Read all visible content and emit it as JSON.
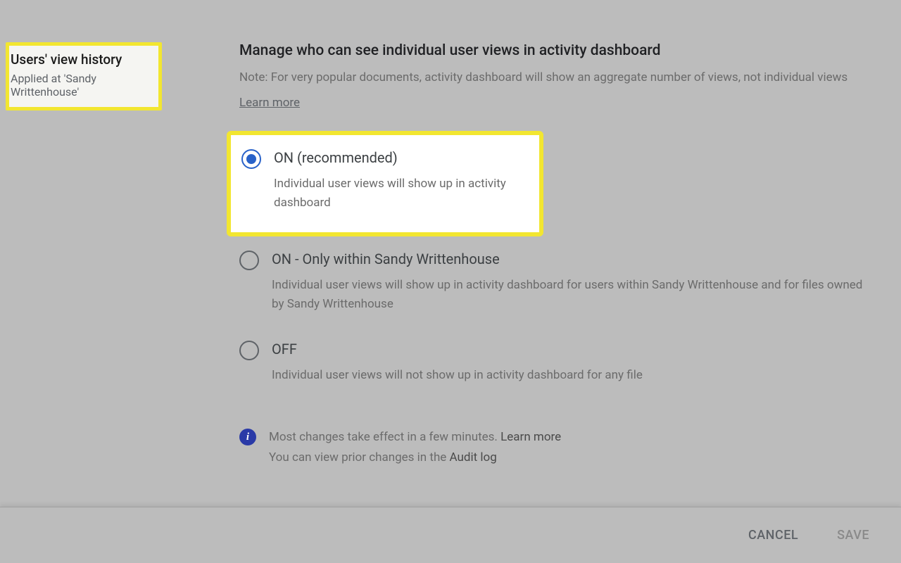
{
  "sidebar": {
    "title": "Users' view history",
    "subtitle": "Applied at 'Sandy Writtenhouse'"
  },
  "main": {
    "heading": "Manage who can see individual user views in activity dashboard",
    "note": "Note: For very popular documents, activity dashboard will show an aggregate number of views, not individual views",
    "learn_more": "Learn more"
  },
  "options": {
    "on": {
      "label": "ON (recommended)",
      "desc": "Individual user views will show up in activity dashboard"
    },
    "on_only": {
      "label": "ON - Only within Sandy Writtenhouse",
      "desc": "Individual user views will show up in activity dashboard for users within Sandy Writtenhouse and for files owned by Sandy Writtenhouse"
    },
    "off": {
      "label": "OFF",
      "desc": "Individual user views will not show up in activity dashboard for any file"
    }
  },
  "info": {
    "line1_pre": "Most changes take effect in a few minutes. ",
    "line1_link": "Learn more",
    "line2_pre": "You can view prior changes in the ",
    "line2_link": "Audit log"
  },
  "footer": {
    "cancel": "CANCEL",
    "save": "SAVE"
  }
}
